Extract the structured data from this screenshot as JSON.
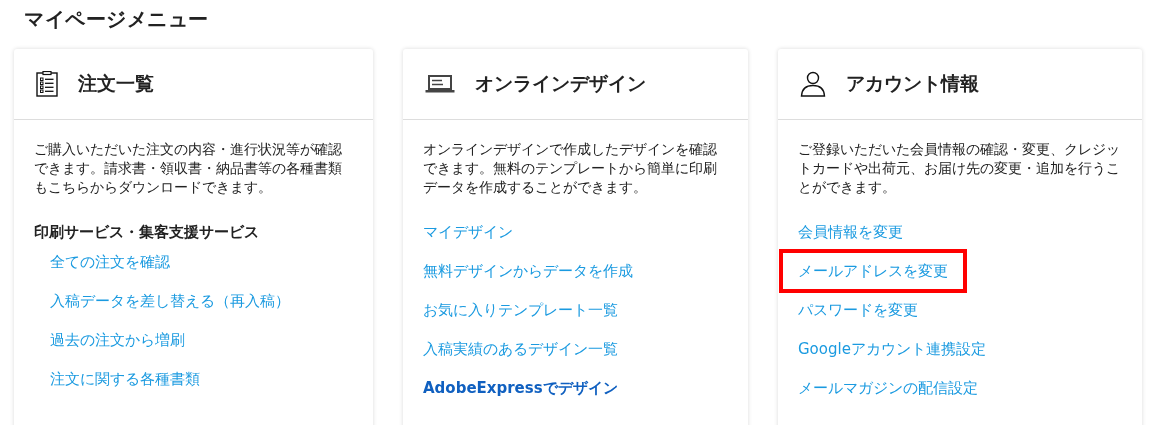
{
  "page_title": "マイページメニュー",
  "cards": [
    {
      "title": "注文一覧",
      "description": "ご購入いただいた注文の内容・進行状況等が確認できます。請求書・領収書・納品書等の各種書類もこちらからダウンロードできます。",
      "items": [
        {
          "kind": "heading",
          "text": "印刷サービス・集客支援サービス",
          "children": [
            {
              "kind": "link",
              "text": "全ての注文を確認",
              "highlighted": false
            },
            {
              "kind": "link",
              "text": "入稿データを差し替える（再入稿）",
              "highlighted": false
            },
            {
              "kind": "link",
              "text": "過去の注文から増刷",
              "highlighted": false
            },
            {
              "kind": "link",
              "text": "注文に関する各種書類",
              "highlighted": false
            }
          ]
        }
      ]
    },
    {
      "title": "オンラインデザイン",
      "description": "オンラインデザインで作成したデザインを確認できます。無料のテンプレートから簡単に印刷データを作成することができます。",
      "items": [
        {
          "kind": "link",
          "text": "マイデザイン",
          "highlighted": false
        },
        {
          "kind": "link",
          "text": "無料デザインからデータを作成",
          "highlighted": false
        },
        {
          "kind": "link",
          "text": "お気に入りテンプレート一覧",
          "highlighted": false
        },
        {
          "kind": "link",
          "text": "入稿実績のあるデザイン一覧",
          "highlighted": false
        },
        {
          "kind": "strong-link",
          "text": "AdobeExpressでデザイン",
          "highlighted": false
        }
      ]
    },
    {
      "title": "アカウント情報",
      "description": "ご登録いただいた会員情報の確認・変更、クレジットカードや出荷元、お届け先の変更・追加を行うことができます。",
      "items": [
        {
          "kind": "link",
          "text": "会員情報を変更",
          "highlighted": false
        },
        {
          "kind": "link",
          "text": "メールアドレスを変更",
          "highlighted": true
        },
        {
          "kind": "link",
          "text": "パスワードを変更",
          "highlighted": false
        },
        {
          "kind": "link",
          "text": "Googleアカウント連携設定",
          "highlighted": false
        },
        {
          "kind": "link",
          "text": "メールマガジンの配信設定",
          "highlighted": false
        }
      ]
    }
  ]
}
